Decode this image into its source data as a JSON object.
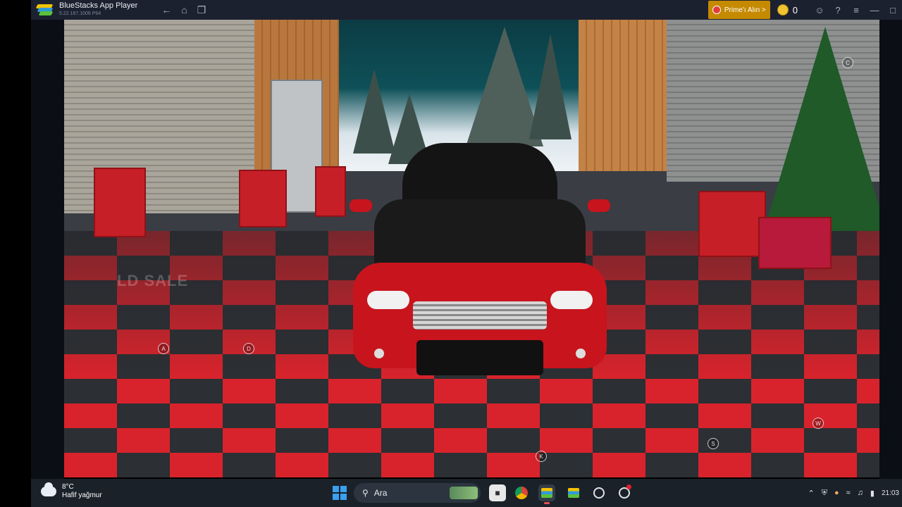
{
  "window": {
    "title": "BlueStacks App Player",
    "version": "5.22.167.1006 P64",
    "prime_button": "Prime'ı Alın >",
    "coin_count": "0"
  },
  "game": {
    "watermark": "LD SALE",
    "control_markers": [
      "A",
      "D",
      "C",
      "W",
      "S",
      "K"
    ]
  },
  "taskbar": {
    "weather_temp": "8°C",
    "weather_desc": "Hafif yağmur",
    "search_placeholder": "Ara",
    "clock": "21:03"
  },
  "colors": {
    "titlebar": "#1c2130",
    "prime_button": "#c58a00",
    "floor_red": "#d8232c",
    "floor_dark": "#2c2f33",
    "car_red": "#c8141d",
    "taskbar": "#1a2129"
  }
}
